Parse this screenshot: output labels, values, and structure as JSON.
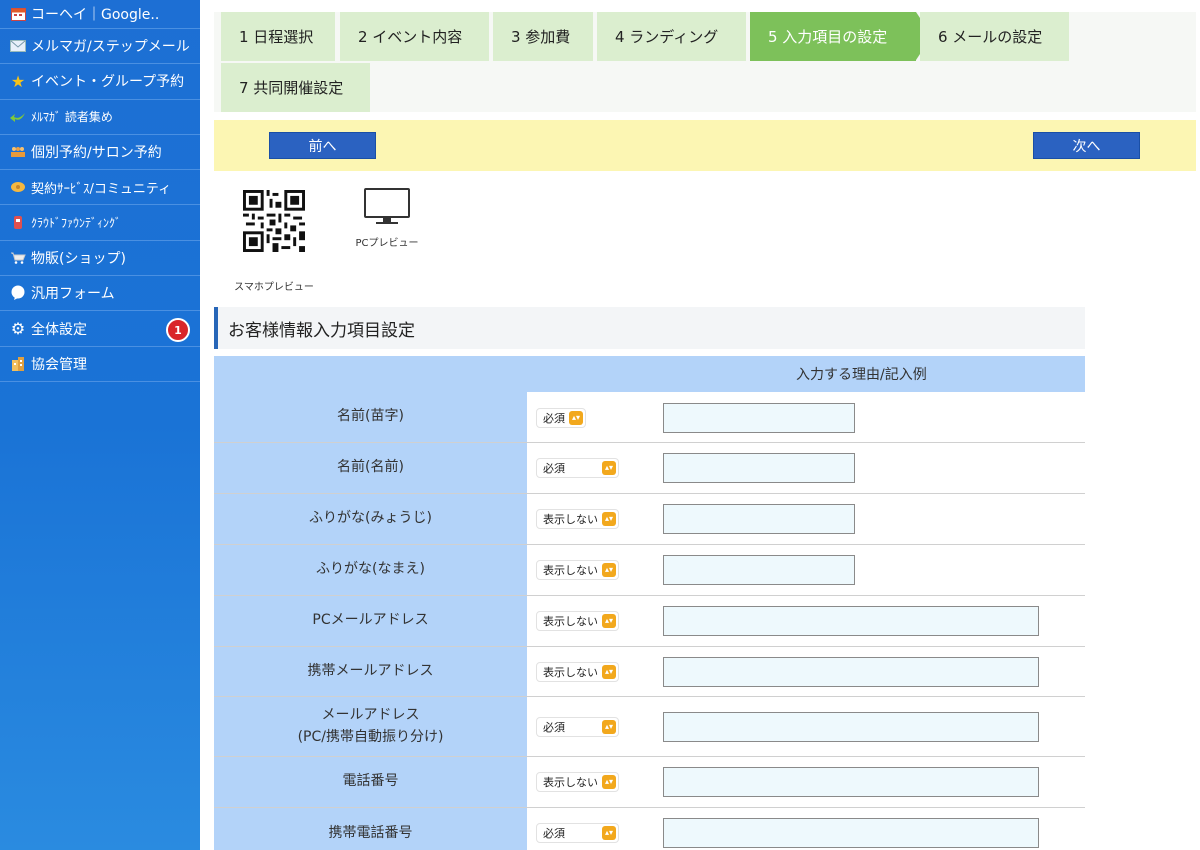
{
  "sidebar": {
    "items": [
      {
        "label": "コーヘイ｜Google..",
        "icon": "calendar-icon",
        "color": "#e06a2a"
      },
      {
        "label": "メルマガ/ステップメール",
        "icon": "mail-icon",
        "color": "#e6eef8"
      },
      {
        "label": "イベント・グループ予約",
        "icon": "star-icon",
        "color": "#f5c21b"
      },
      {
        "label": "ﾒﾙﾏｶﾞ 読者集め",
        "icon": "arrow-icon",
        "color": "#7fc83a"
      },
      {
        "label": "個別予約/サロン予約",
        "icon": "people-icon",
        "color": "#f0a040"
      },
      {
        "label": "契約ｻｰﾋﾞｽ/コミュニティ",
        "icon": "community-icon",
        "color": "#f5b840"
      },
      {
        "label": "ｸﾗｳﾄﾞﾌｧｳﾝﾃﾞｨﾝｸﾞ",
        "icon": "crowdfunding-icon",
        "color": "#e05050"
      },
      {
        "label": "物販(ショップ)",
        "icon": "cart-icon",
        "color": "#f0f0f0"
      },
      {
        "label": "汎用フォーム",
        "icon": "bubble-icon",
        "color": "#ffffff"
      },
      {
        "label": "全体設定",
        "icon": "gear-icon",
        "color": "#ffffff",
        "badge": "1"
      },
      {
        "label": "協会管理",
        "icon": "building-icon",
        "color": "#f0c060"
      }
    ]
  },
  "tabs": [
    {
      "label": "1 日程選択"
    },
    {
      "label": "2 イベント内容"
    },
    {
      "label": "3 参加費"
    },
    {
      "label": "4 ランディング"
    },
    {
      "label": "5 入力項目の設定",
      "active": true
    },
    {
      "label": "6 メールの設定"
    },
    {
      "label": "7 共同開催設定"
    }
  ],
  "nav": {
    "prev": "前へ",
    "next": "次へ"
  },
  "preview": {
    "mobile": "スマホプレビュー",
    "pc": "PCプレビュー"
  },
  "section": {
    "title": "お客様情報入力項目設定"
  },
  "table": {
    "header": "入力する理由/記入例",
    "rows": [
      {
        "label": "名前(苗字)",
        "select": "必須"
      },
      {
        "label": "名前(名前)",
        "select": "必須"
      },
      {
        "label": "ふりがな(みょうじ)",
        "select": "表示しない"
      },
      {
        "label": "ふりがな(なまえ)",
        "select": "表示しない"
      },
      {
        "label": "PCメールアドレス",
        "select": "表示しない"
      },
      {
        "label": "携帯メールアドレス",
        "select": "表示しない"
      },
      {
        "label": "メールアドレス\n(PC/携帯自動振り分け)",
        "select": "必須"
      },
      {
        "label": "電話番号",
        "select": "表示しない"
      },
      {
        "label": "携帯電話番号",
        "select": "必須"
      }
    ]
  }
}
